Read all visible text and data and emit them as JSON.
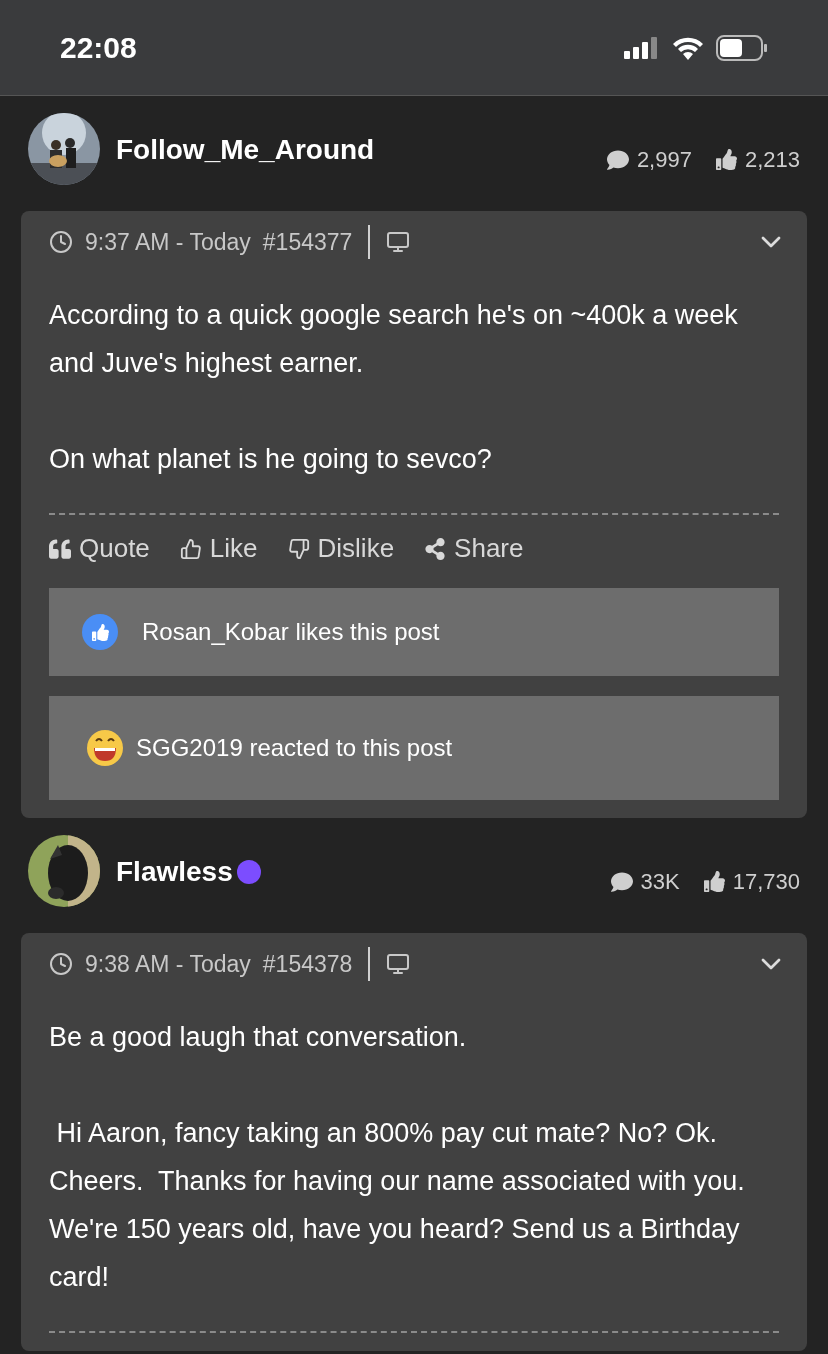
{
  "status_bar": {
    "time": "22:08"
  },
  "posts": [
    {
      "author": {
        "name": "Follow_Me_Around",
        "verified": false
      },
      "stats": {
        "comments": "2,997",
        "likes": "2,213"
      },
      "meta": {
        "time": "9:37 AM - Today",
        "number": "#154377"
      },
      "body": [
        "According to a quick google search he's on ~400k a week and Juve's highest earner.",
        "On what planet is he going to sevco?"
      ],
      "actions": [
        {
          "kind": "quote",
          "label": "Quote"
        },
        {
          "kind": "like",
          "label": "Like"
        },
        {
          "kind": "dislike",
          "label": "Dislike"
        },
        {
          "kind": "share",
          "label": "Share"
        }
      ],
      "reactions": [
        {
          "kind": "like",
          "text": "Rosan_Kobar likes this post"
        },
        {
          "kind": "laugh",
          "text": "SGG2019 reacted to this post"
        }
      ]
    },
    {
      "author": {
        "name": "Flawless",
        "verified": true
      },
      "stats": {
        "comments": "33K",
        "likes": "17,730"
      },
      "meta": {
        "time": "9:38 AM - Today",
        "number": "#154378"
      },
      "body": [
        "Be a good laugh that conversation.",
        " Hi Aaron, fancy taking an 800% pay cut mate? No? Ok.  Cheers.  Thanks for having our name associated with you.  We're 150 years old, have you heard? Send us a Birthday card!"
      ]
    }
  ]
}
